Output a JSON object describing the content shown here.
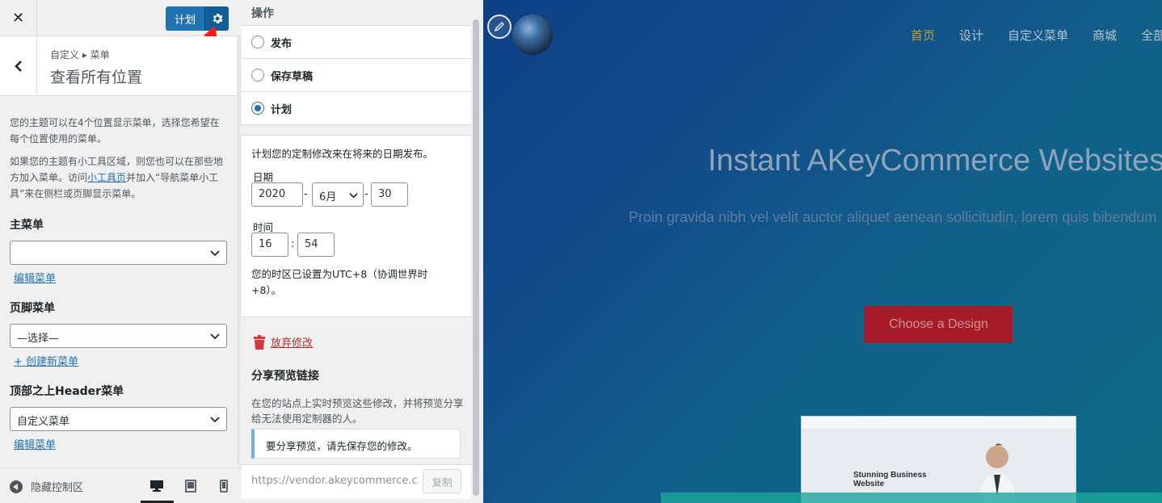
{
  "left_panel": {
    "close_icon": "close-icon",
    "schedule_button": "计划",
    "gear_icon": "gear-icon",
    "breadcrumb": "自定义 ▸ 菜单",
    "section_title": "查看所有位置",
    "description_1": "您的主题可以在4个位置显示菜单，选择您希望在每个位置使用的菜单。",
    "description_2_pre": "如果您的主题有小工具区域，则您也可以在那些地方加入菜单。访问",
    "description_2_link": "小工具页",
    "description_2_post": "并加入“导航菜单小工具”来在侧栏或页脚显示菜单。",
    "locations": [
      {
        "title": "主菜单",
        "selected": "",
        "link": "编辑菜单"
      },
      {
        "title": "页脚菜单",
        "selected": "—选择—",
        "link": "+ 创建新菜单"
      },
      {
        "title": "顶部之上Header菜单",
        "selected": "自定义菜单",
        "link": "编辑菜单"
      }
    ],
    "footer": {
      "hide_controls": "隐藏控制区"
    }
  },
  "publish_settings": {
    "heading": "操作",
    "options": [
      {
        "label": "发布",
        "checked": false
      },
      {
        "label": "保存草稿",
        "checked": false
      },
      {
        "label": "计划",
        "checked": true
      }
    ],
    "schedule_intro": "计划您的定制修改来在将来的日期发布。",
    "date_label": "日期",
    "year": "2020",
    "month": "6月",
    "day": "30",
    "time_label": "时间",
    "hour": "16",
    "minute": "54",
    "timezone_note": "您的时区已设置为UTC+8（协调世界时+8）。",
    "discard": "放弃修改",
    "share_title": "分享预览链接",
    "share_desc": "在您的站点上实时预览这些修改，并将预览分享给无法使用定制器的人。",
    "share_notice": "要分享预览，请先保存您的修改。",
    "share_url": "https://vendor.akeycommerce.com",
    "copy_button": "复制"
  },
  "preview": {
    "nav": [
      "首页",
      "设计",
      "自定义菜单",
      "商城",
      "全部"
    ],
    "hero_title": "Instant AKeyCommerce Websites",
    "hero_subtitle": "Proin gravida nibh vel velit auctor aliquet aenean sollicitudin, lorem quis bibendum",
    "cta": "Choose a Design",
    "mock_title": "Stunning Business Website"
  },
  "colors": {
    "primary": "#2271b1",
    "accent_nav": "#b8a227",
    "cta": "#a51b2a",
    "discard": "#b32d2e"
  }
}
